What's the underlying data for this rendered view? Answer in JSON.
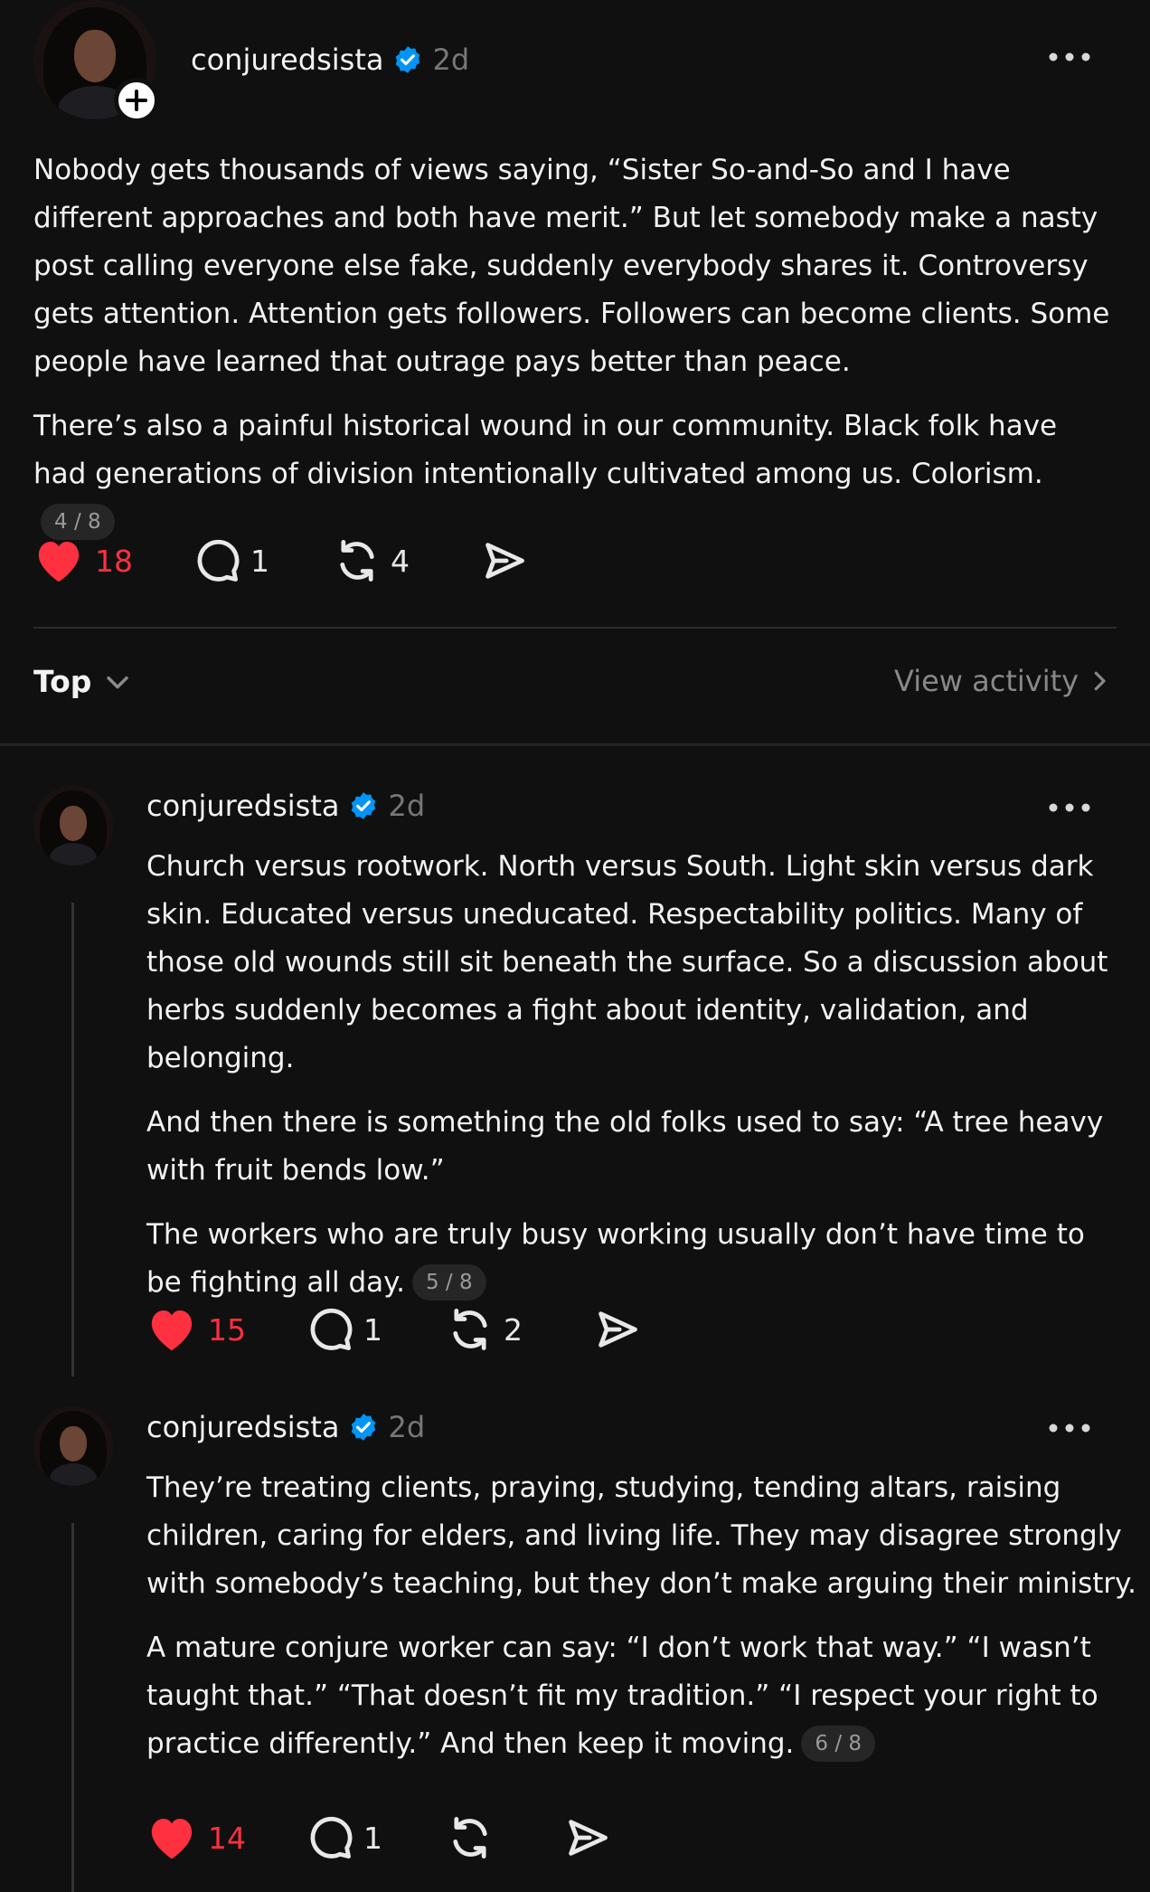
{
  "main_post": {
    "username": "conjuredsista",
    "time": "2d",
    "paragraphs": [
      "Nobody gets thousands of views saying, “Sister So-and-So and I have different approaches and both have merit.” But let somebody make a nasty post calling everyone else fake, suddenly everybody shares it. Controversy gets attention. Attention gets followers. Followers can become clients. Some people have learned that outrage pays better than peace.",
      "There’s also a painful historical wound in our community. Black folk have had generations of division intentionally cultivated among us. Colorism."
    ],
    "pager": "4 / 8",
    "likes": "18",
    "replies": "1",
    "reposts": "4"
  },
  "sort_bar": {
    "sort_label": "Top",
    "activity_label": "View activity"
  },
  "replies": [
    {
      "username": "conjuredsista",
      "time": "2d",
      "paragraphs": [
        "Church versus rootwork. North versus South. Light skin versus dark skin. Educated versus uneducated. Respectability politics. Many of those old wounds still sit beneath the surface. So a discussion about herbs suddenly becomes a fight about identity, validation, and belonging.",
        "And then there is something the old folks used to say: “A tree heavy with fruit bends low.”",
        "The workers who are truly busy working usually don’t have time to be fighting all day."
      ],
      "pager": "5 / 8",
      "likes": "15",
      "replies": "1",
      "reposts": "2"
    },
    {
      "username": "conjuredsista",
      "time": "2d",
      "paragraphs": [
        "They’re treating clients, praying, studying, tending altars, raising children, caring for elders, and living life. They may disagree strongly with somebody’s teaching, but they don’t make arguing their ministry.",
        "A mature conjure worker can say: “I don’t work that way.” “I wasn’t taught that.” “That doesn’t fit my tradition.” “I respect your right to practice differently.” And then keep it moving."
      ],
      "pager": "6 / 8",
      "likes": "14",
      "replies": "1",
      "reposts": ""
    }
  ],
  "colors": {
    "background": "#101010",
    "like_red": "#ff3040",
    "verified_blue": "#0095f6",
    "muted_text": "#777777"
  },
  "icons": [
    "plus-icon",
    "verified-badge-icon",
    "more-icon",
    "heart-icon",
    "comment-icon",
    "repost-icon",
    "share-icon",
    "chevron-down-icon",
    "chevron-right-icon"
  ]
}
